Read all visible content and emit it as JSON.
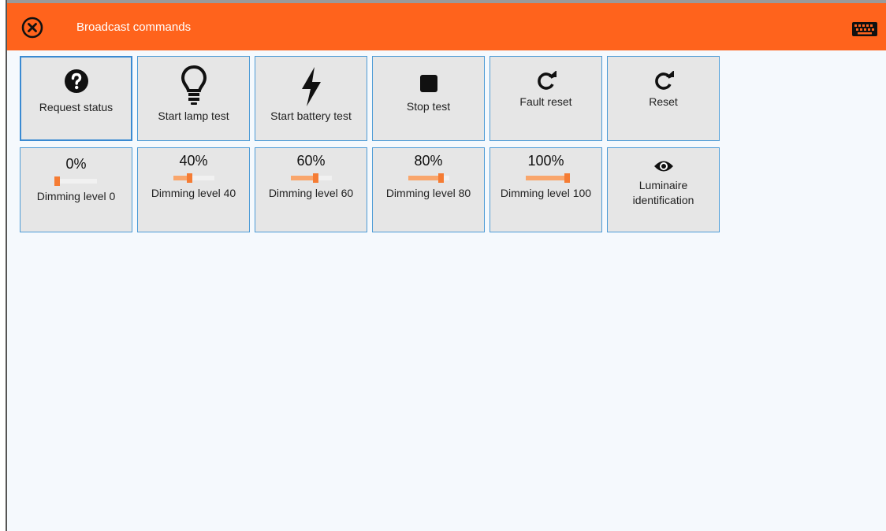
{
  "window": {
    "title": "Broadcast commands"
  },
  "icons": {
    "close": "close-circle-icon",
    "keyboard": "keyboard-icon"
  },
  "colors": {
    "titlebar": "#ff631c",
    "tile_bg": "#e6e6e6",
    "tile_border": "#4c9bd6",
    "slider_fill": "#f9a66c",
    "slider_thumb": "#f57c34"
  },
  "commands": [
    {
      "label": "Request status",
      "icon": "question-circle-icon",
      "selected": true
    },
    {
      "label": "Start lamp test",
      "icon": "lightbulb-icon"
    },
    {
      "label": "Start battery test",
      "icon": "lightning-bolt-icon"
    },
    {
      "label": "Stop test",
      "icon": "stop-square-icon"
    },
    {
      "label": "Fault reset",
      "icon": "refresh-icon"
    },
    {
      "label": "Reset",
      "icon": "refresh-icon"
    }
  ],
  "dimming": [
    {
      "percent_text": "0%",
      "level": 0,
      "label": "Dimming level 0"
    },
    {
      "percent_text": "40%",
      "level": 40,
      "label": "Dimming level 40"
    },
    {
      "percent_text": "60%",
      "level": 60,
      "label": "Dimming level 60"
    },
    {
      "percent_text": "80%",
      "level": 80,
      "label": "Dimming level 80"
    },
    {
      "percent_text": "100%",
      "level": 100,
      "label": "Dimming level 100"
    }
  ],
  "identify": {
    "label": "Luminaire identification",
    "icon": "eye-icon"
  }
}
